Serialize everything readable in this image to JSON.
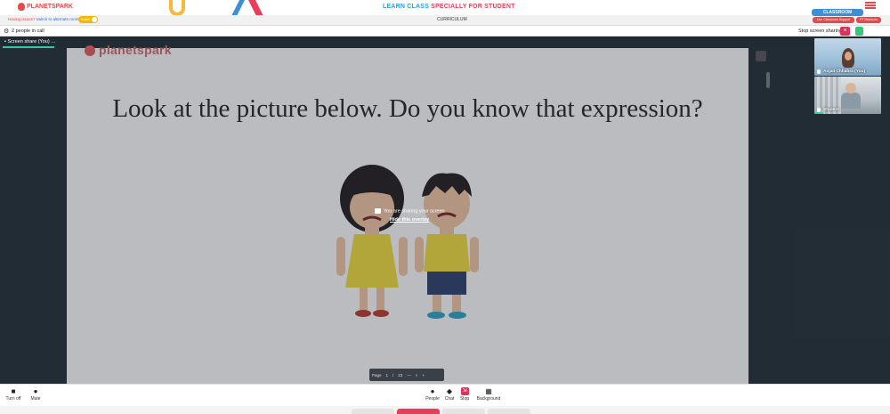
{
  "app": {
    "brand": "PLANETSPARK"
  },
  "header": {
    "headline_part1": "LEARN CLASS",
    "headline_part2": "SPECIALLY FOR STUDENT",
    "curriculum_label": "CURRICULUM",
    "classroom_button": "CLASSROOM",
    "live_support_button": "Live Classroom Support",
    "pt_button": "PT Moments",
    "issues_text": "Having issues?",
    "issues_link": "switch to alternate room",
    "switch_label": "Switch"
  },
  "call": {
    "people_count": "2 people in call",
    "stop_sharing": "Stop screen sharing",
    "tab_label": "Screen share (You)"
  },
  "slide": {
    "brand": "planetspark",
    "title": "Look at the picture below. Do you know that expression?"
  },
  "overlay": {
    "message": "You are sharing your screen",
    "hide_link": "Hide this overlay"
  },
  "page_toolbar": {
    "label": "Page",
    "current": "1",
    "separator": "/",
    "total": "23"
  },
  "participants": [
    {
      "name": "Anjali Chhabra (You)"
    },
    {
      "name": "Student"
    }
  ],
  "controls": {
    "turn_off": "Turn off",
    "mute": "Mute",
    "people": "People",
    "chat": "Chat",
    "stop": "Stop",
    "background": "Background"
  },
  "colors": {
    "brand_red": "#e5484d",
    "accent_blue": "#2d9fdb",
    "call_bg": "#202b33",
    "stop_red": "#e0305a",
    "active_tab": "#3cc6a4"
  }
}
